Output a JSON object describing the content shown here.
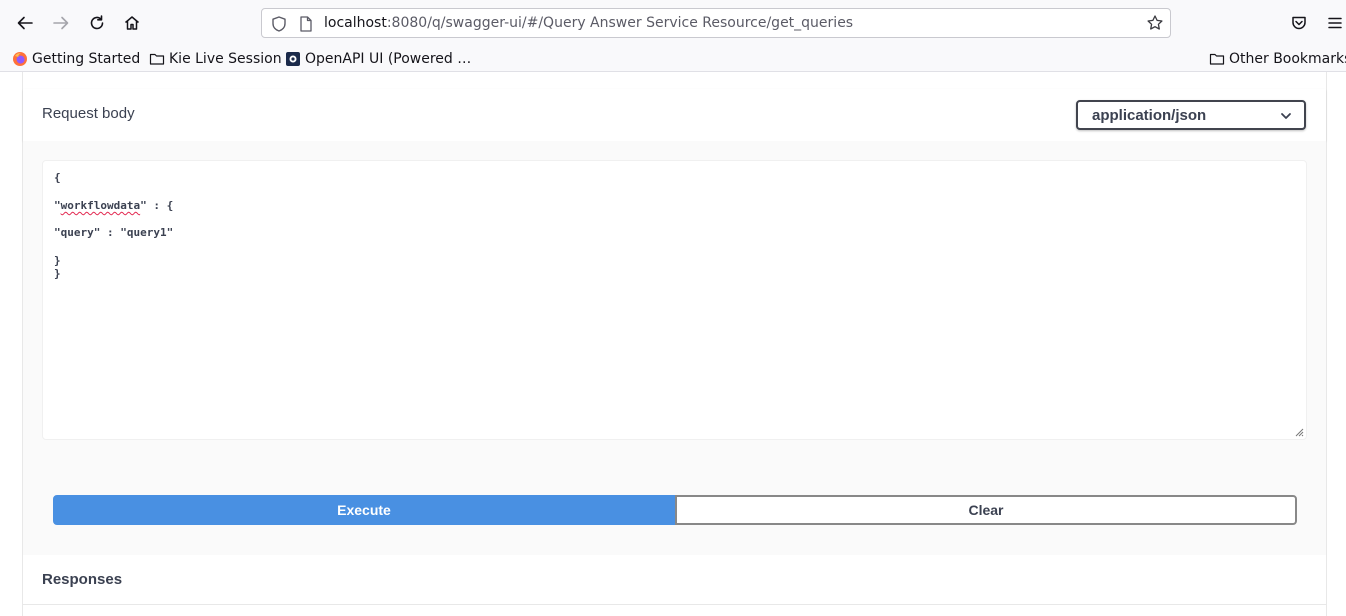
{
  "browser": {
    "url_host": "localhost",
    "url_rest": ":8080/q/swagger-ui/#/Query Answer Service Resource/get_queries",
    "bookmarks": [
      {
        "label": "Getting Started",
        "icon": "firefox-icon"
      },
      {
        "label": "Kie Live Session",
        "icon": "folder-icon"
      },
      {
        "label": "OpenAPI UI (Powered …",
        "icon": "openapi-icon"
      }
    ],
    "other_bookmarks": "Other Bookmarks"
  },
  "request_body": {
    "title": "Request body",
    "content_type": "application/json",
    "code_lines": [
      "{",
      "\"workflowdata\" : {",
      "\"query\" : \"query1\"",
      "}",
      "}"
    ]
  },
  "actions": {
    "execute_label": "Execute",
    "clear_label": "Clear"
  },
  "responses": {
    "title": "Responses"
  },
  "colors": {
    "execute": "#4990e2",
    "text": "#3b4151",
    "spellcheck": "#e22850"
  }
}
